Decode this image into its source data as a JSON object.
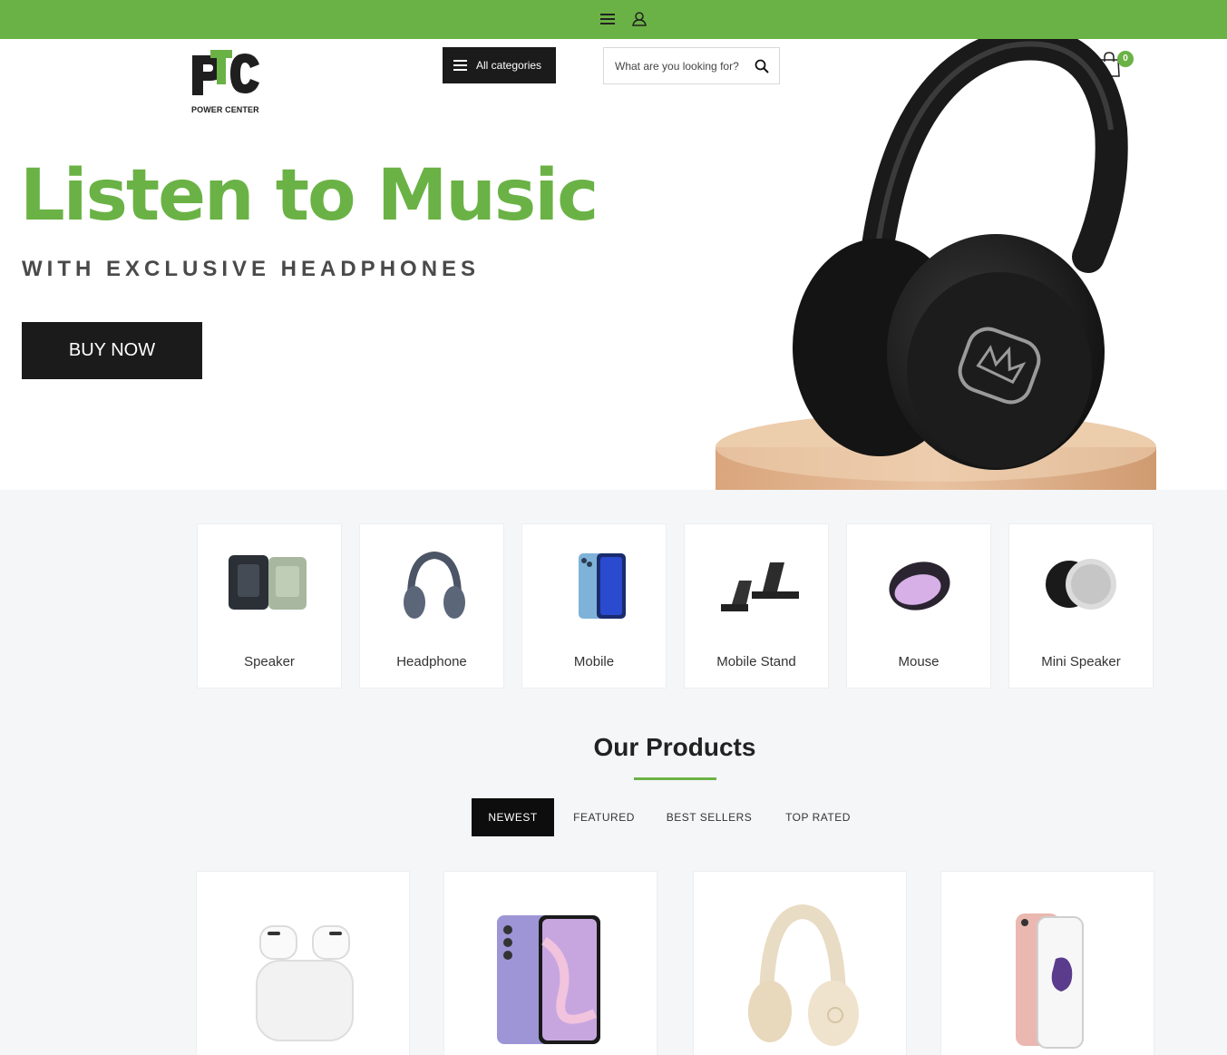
{
  "topbar": {
    "background": "#6ab245",
    "menu_icon": "hamburger-icon",
    "user_icon": "user-icon"
  },
  "header": {
    "logo_caption": "POWER CENTER",
    "all_categories_label": "All categories",
    "search_placeholder": "What are you looking for?",
    "search_icon": "search-icon",
    "cart_icon": "shopping-bag-icon",
    "cart_count": "0"
  },
  "hero": {
    "title": "Listen to Music",
    "subtitle": "WITH EXCLUSIVE HEADPHONES",
    "cta_label": "BUY NOW",
    "accent_color": "#6ab245",
    "image_icon": "headphones-on-pedestal-image"
  },
  "categories": [
    {
      "label": "Speaker",
      "icon": "speaker-image"
    },
    {
      "label": "Headphone",
      "icon": "headphone-image"
    },
    {
      "label": "Mobile",
      "icon": "mobile-image"
    },
    {
      "label": "Mobile Stand",
      "icon": "mobile-stand-image"
    },
    {
      "label": "Mouse",
      "icon": "mouse-image"
    },
    {
      "label": "Mini Speaker",
      "icon": "mini-speaker-image"
    }
  ],
  "products_section": {
    "title": "Our Products",
    "tabs": [
      {
        "label": "NEWEST",
        "active": true
      },
      {
        "label": "FEATURED",
        "active": false
      },
      {
        "label": "BEST SELLERS",
        "active": false
      },
      {
        "label": "TOP RATED",
        "active": false
      }
    ],
    "products": [
      {
        "icon": "earbuds-case-image"
      },
      {
        "icon": "smartphone-image"
      },
      {
        "icon": "cream-headphones-image"
      },
      {
        "icon": "rose-gold-phone-image"
      }
    ]
  }
}
